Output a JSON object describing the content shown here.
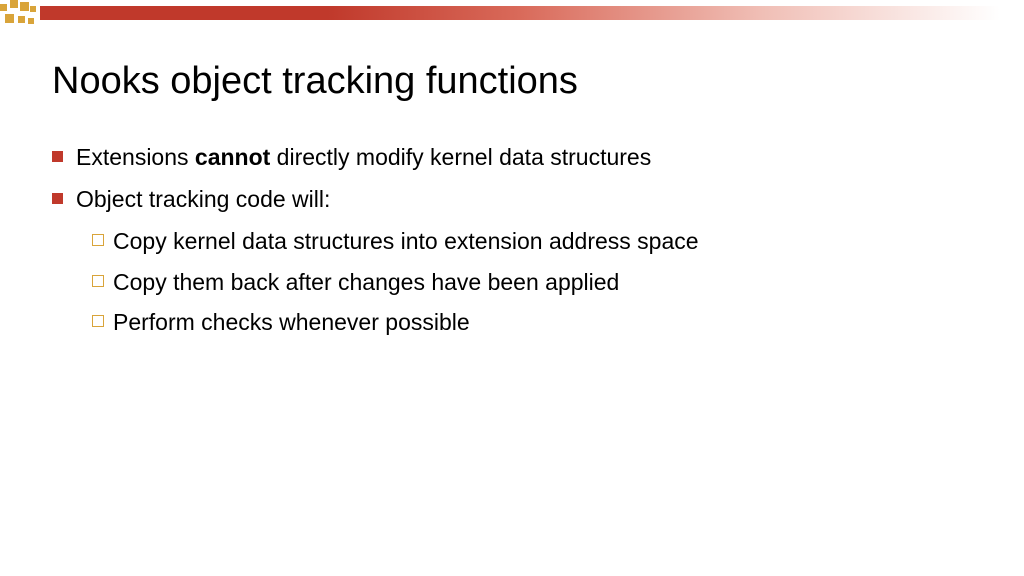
{
  "slide": {
    "title": "Nooks object tracking functions",
    "bullets": [
      {
        "prefix": "Extensions ",
        "bold": "cannot",
        "suffix": " directly modify kernel data structures"
      },
      {
        "text": "Object tracking code will:"
      }
    ],
    "sub_bullets": [
      "Copy kernel data structures into extension address space",
      "Copy them back after changes have been applied",
      "Perform checks whenever possible"
    ]
  }
}
